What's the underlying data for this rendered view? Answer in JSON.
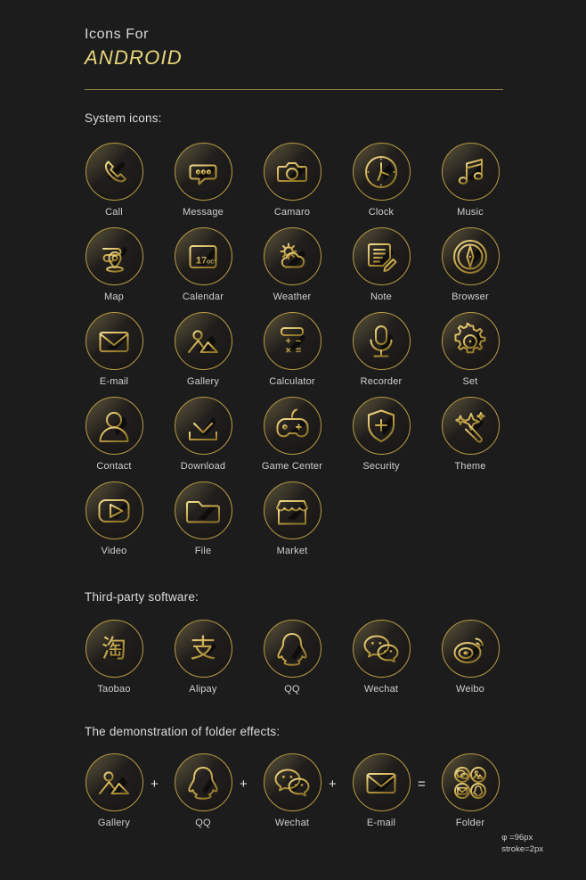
{
  "header": {
    "title_line1": "Icons  For",
    "title_line2": "ANDROID"
  },
  "sections": {
    "system": "System icons:",
    "third_party": "Third-party software:",
    "folder_demo": "The demonstration of folder effects:"
  },
  "system_icons": [
    [
      {
        "label": "Call",
        "icon": "phone-icon"
      },
      {
        "label": "Message",
        "icon": "chat-bubble-icon"
      },
      {
        "label": "Camaro",
        "icon": "camera-icon"
      },
      {
        "label": "Clock",
        "icon": "clock-icon"
      },
      {
        "label": "Music",
        "icon": "music-note-icon"
      }
    ],
    [
      {
        "label": "Map",
        "icon": "map-pin-icon"
      },
      {
        "label": "Calendar",
        "icon": "calendar-icon",
        "day": "17",
        "month": "OCT"
      },
      {
        "label": "Weather",
        "icon": "sun-cloud-icon"
      },
      {
        "label": "Note",
        "icon": "note-pencil-icon"
      },
      {
        "label": "Browser",
        "icon": "compass-icon"
      }
    ],
    [
      {
        "label": "E-mail",
        "icon": "envelope-icon"
      },
      {
        "label": "Gallery",
        "icon": "picture-mountain-icon"
      },
      {
        "label": "Calculator",
        "icon": "calculator-icon",
        "keys": [
          "+",
          "−",
          "×",
          "="
        ]
      },
      {
        "label": "Recorder",
        "icon": "microphone-icon"
      },
      {
        "label": "Set",
        "icon": "gear-icon"
      }
    ],
    [
      {
        "label": "Contact",
        "icon": "person-icon"
      },
      {
        "label": "Download",
        "icon": "download-arrow-icon"
      },
      {
        "label": "Game Center",
        "icon": "gamepad-icon"
      },
      {
        "label": "Security",
        "icon": "shield-plus-icon"
      },
      {
        "label": "Theme",
        "icon": "magic-wand-sparkle-icon"
      }
    ],
    [
      {
        "label": "Video",
        "icon": "play-button-icon"
      },
      {
        "label": "File",
        "icon": "folder-icon"
      },
      {
        "label": "Market",
        "icon": "storefront-icon"
      }
    ]
  ],
  "third_party_icons": [
    [
      {
        "label": "Taobao",
        "icon": "taobao-icon",
        "glyph": "淘"
      },
      {
        "label": "Alipay",
        "icon": "alipay-icon",
        "glyph": "支"
      },
      {
        "label": "QQ",
        "icon": "qq-penguin-icon"
      },
      {
        "label": "Wechat",
        "icon": "wechat-bubbles-icon"
      },
      {
        "label": "Weibo",
        "icon": "weibo-eye-icon"
      }
    ]
  ],
  "folder_demo": {
    "items": [
      {
        "label": "Gallery",
        "icon": "picture-mountain-icon"
      },
      {
        "label": "QQ",
        "icon": "qq-penguin-icon"
      },
      {
        "label": "Wechat",
        "icon": "wechat-bubbles-icon"
      },
      {
        "label": "E-mail",
        "icon": "envelope-icon"
      },
      {
        "label": "Folder",
        "icon": "folder-group-icon"
      }
    ],
    "operators": [
      "+",
      "+",
      "+",
      "="
    ]
  },
  "footnote": {
    "diameter": "φ =96px",
    "stroke": "stroke=2px"
  },
  "colors": {
    "background": "#1c1c1c",
    "gold": "#c8a84a",
    "gold_light": "#e8d77a",
    "text": "#d8d8d8",
    "divider": "#9a8a4a"
  }
}
